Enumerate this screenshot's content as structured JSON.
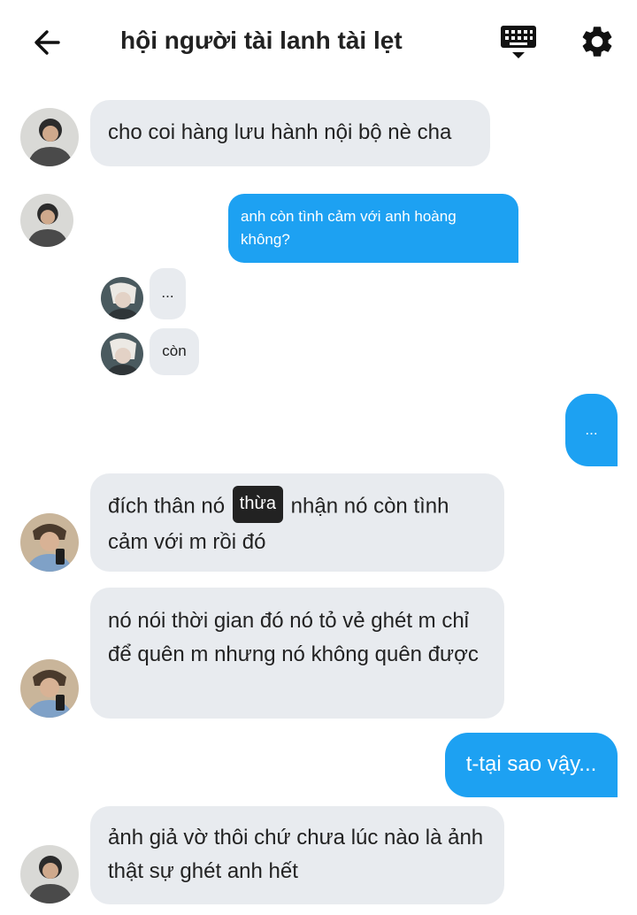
{
  "header": {
    "title": "hội người tài lanh tài lẹt"
  },
  "messages": {
    "m1": "cho coi hàng lưu hành nội bộ nè cha",
    "m2": "anh còn tình cảm với anh hoàng không?",
    "m3": "...",
    "m4": "còn",
    "m5": "...",
    "m6_before": "đích thân nó",
    "m6_tooltip": "thừa",
    "m6_after": "nhận nó còn tình cảm với m rồi đó",
    "m7": "nó nói thời gian đó nó tỏ vẻ ghét m chỉ để quên m nhưng nó không quên được",
    "m8": "t-tại sao vậy...",
    "m9": "ảnh giả vờ thôi chứ chưa lúc nào là ảnh thật sự ghét anh hết"
  },
  "colors": {
    "incoming_bubble": "#e8ebef",
    "outgoing_bubble": "#1da1f2",
    "tooltip_bg": "#222222"
  },
  "icons": {
    "back": "arrow-left-icon",
    "keyboard": "keyboard-icon",
    "settings": "gear-icon"
  }
}
